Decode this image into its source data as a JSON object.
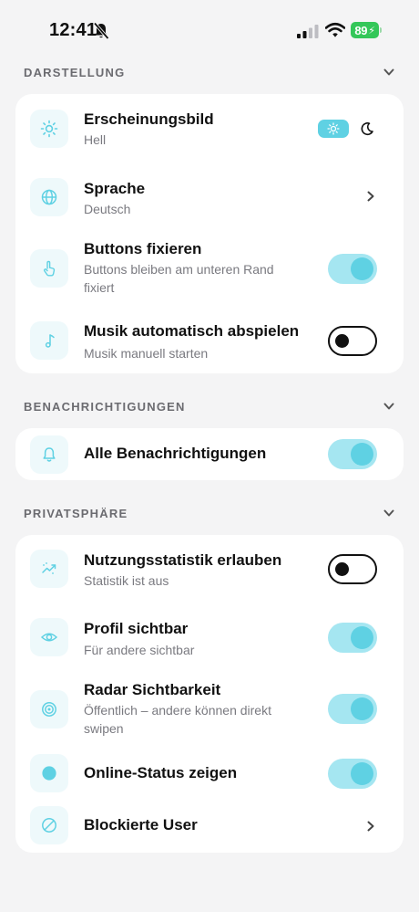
{
  "status_bar": {
    "time": "12:41",
    "battery": "89"
  },
  "sections": {
    "darstellung": {
      "title": "DARSTELLUNG",
      "rows": {
        "appearance": {
          "title": "Erscheinungsbild",
          "subtitle": "Hell"
        },
        "language": {
          "title": "Sprache",
          "subtitle": "Deutsch"
        },
        "fix_buttons": {
          "title": "Buttons fixieren",
          "subtitle": "Buttons bleiben am unteren Rand fixiert",
          "enabled": true
        },
        "autoplay_music": {
          "title": "Musik automatisch abspielen",
          "subtitle": "Musik manuell starten",
          "enabled": false
        }
      }
    },
    "benachrichtigungen": {
      "title": "BENACHRICHTIGUNGEN",
      "rows": {
        "all_notifications": {
          "title": "Alle Benachrichtigungen",
          "enabled": true
        }
      }
    },
    "privatsphaere": {
      "title": "PRIVATSPHÄRE",
      "rows": {
        "usage_stats": {
          "title": "Nutzungsstatistik erlauben",
          "subtitle": "Statistik ist aus",
          "enabled": false
        },
        "profile_visible": {
          "title": "Profil sichtbar",
          "subtitle": "Für andere sichtbar",
          "enabled": true
        },
        "radar_visibility": {
          "title": "Radar Sichtbarkeit",
          "subtitle": "Öffentlich – andere können direkt swipen",
          "enabled": true
        },
        "online_status": {
          "title": "Online-Status zeigen",
          "enabled": true
        },
        "blocked_users": {
          "title": "Blockierte User"
        }
      }
    }
  },
  "theme": {
    "selected": "light"
  },
  "icons": {
    "appearance": "sun-icon",
    "language": "globe-icon",
    "fix_buttons": "hand-pointer-icon",
    "autoplay_music": "music-note-icon",
    "all_notifications": "bell-icon",
    "usage_stats": "trend-chart-icon",
    "profile_visible": "eye-icon",
    "radar_visibility": "radar-icon",
    "online_status": "online-dot-icon",
    "blocked_users": "block-icon"
  },
  "colors": {
    "accent": "#5fd1e3",
    "toggle_track_on": "#a5e6f1",
    "icon_tile": "#eef9fb",
    "background": "#f4f4f5",
    "battery": "#34c759"
  }
}
